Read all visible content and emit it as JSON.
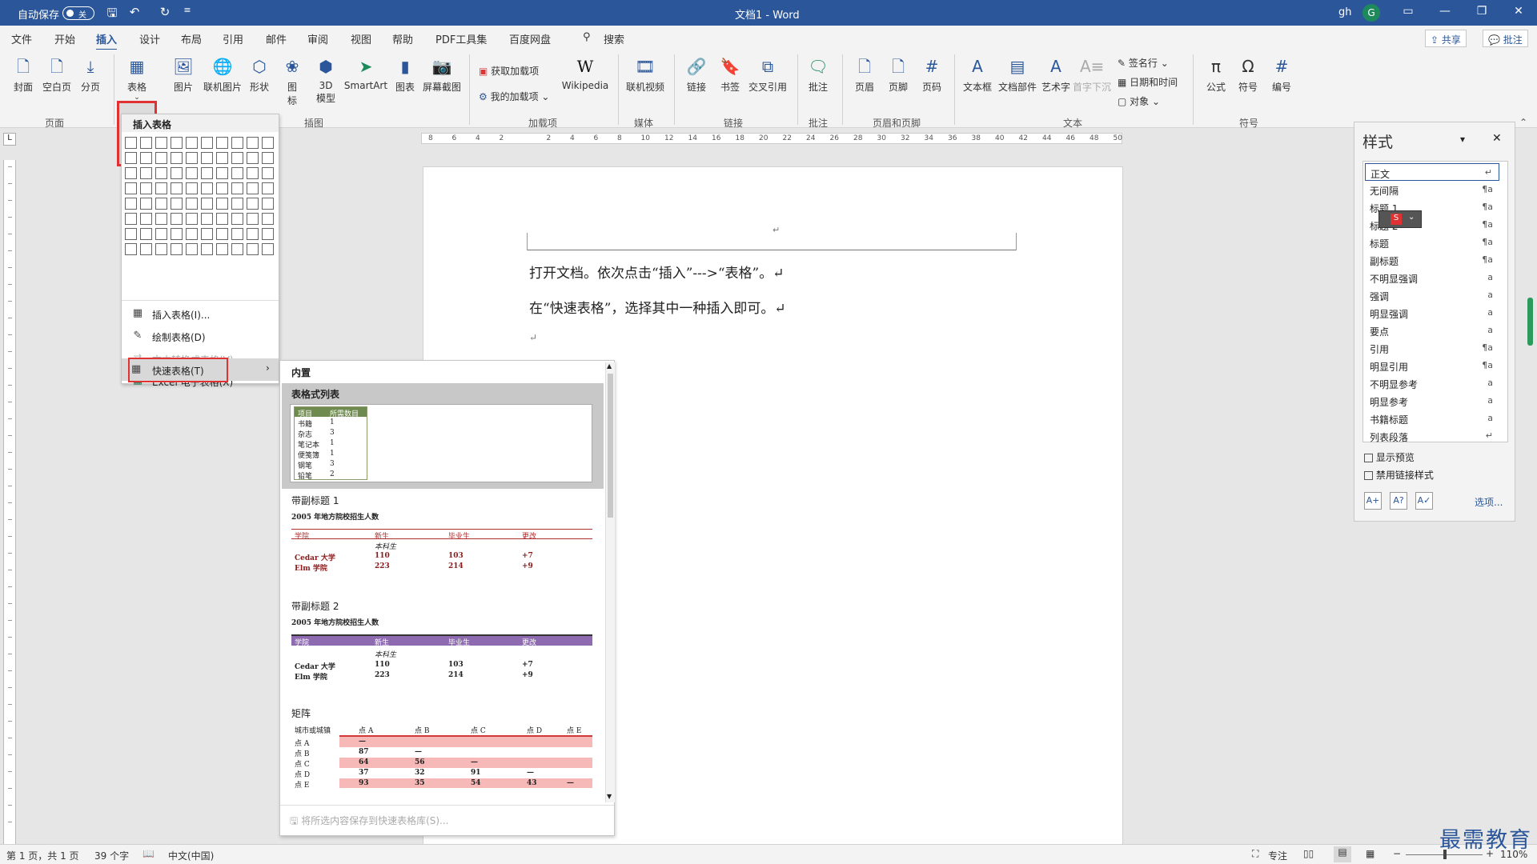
{
  "titlebar": {
    "autosave": "自动保存",
    "autosave_state": "关",
    "doc_title": "文档1 - Word",
    "user": "gh",
    "avatar": "G"
  },
  "tabs": [
    "文件",
    "开始",
    "插入",
    "设计",
    "布局",
    "引用",
    "邮件",
    "审阅",
    "视图",
    "帮助",
    "PDF工具集",
    "百度网盘"
  ],
  "search_label": "搜索",
  "share_label": "共享",
  "comment_label": "批注",
  "ribbon": {
    "page_group": {
      "label": "页面",
      "cover": "封面",
      "blank": "空白页",
      "break": "分页"
    },
    "table": "表格",
    "illus": {
      "label": "插图",
      "picture": "图片",
      "online_picture": "联机图片",
      "shapes": "形状",
      "icons_1": "图",
      "icons_2": "标",
      "model_1": "3D",
      "model_2": "模型",
      "smartart": "SmartArt",
      "chart": "图表",
      "screenshot": "屏幕截图"
    },
    "addins": {
      "label": "加载项",
      "get": "获取加载项",
      "mine": "我的加载项",
      "wikipedia": "Wikipedia"
    },
    "media": {
      "label": "媒体",
      "video": "联机视频"
    },
    "links": {
      "label": "链接",
      "link": "链接",
      "bookmark": "书签",
      "cross": "交叉引用"
    },
    "comments": {
      "label": "批注",
      "comment": "批注"
    },
    "hf": {
      "label": "页眉和页脚",
      "header": "页眉",
      "footer": "页脚",
      "pagenum": "页码"
    },
    "text": {
      "label": "文本",
      "textbox": "文本框",
      "quickparts": "文档部件",
      "wordart": "艺术字",
      "dropcap": "首字下沉",
      "signature": "签名行",
      "datetime": "日期和时间",
      "object": "对象"
    },
    "symbols": {
      "label": "符号",
      "equation": "公式",
      "symbol": "符号",
      "number": "编号"
    }
  },
  "dropdown": {
    "header": "插入表格",
    "items": [
      "插入表格(I)...",
      "绘制表格(D)",
      "文本转换成表格(V)...",
      "Excel 电子表格(X)",
      "快速表格(T)"
    ]
  },
  "submenu": {
    "header": "内置",
    "footer": "将所选内容保存到快速表格库(S)...",
    "g1": {
      "title": "表格式列表",
      "headers": [
        "项目",
        "所需数目"
      ],
      "rows": [
        [
          "书籍",
          "1"
        ],
        [
          "杂志",
          "3"
        ],
        [
          "笔记本",
          "1"
        ],
        [
          "便笺簿",
          "1"
        ],
        [
          "钢笔",
          "3"
        ],
        [
          "铅笔",
          "2"
        ]
      ]
    },
    "g2": {
      "title": "带副标题 1",
      "caption": "2005 年地方院校招生人数",
      "headers": [
        "学院",
        "新生",
        "毕业生",
        "更改"
      ],
      "sub": "本科生",
      "rows": [
        [
          "Cedar 大学",
          "110",
          "103",
          "+7"
        ],
        [
          "Elm 学院",
          "223",
          "214",
          "+9"
        ]
      ]
    },
    "g3": {
      "title": "带副标题 2",
      "caption": "2005 年地方院校招生人数",
      "headers": [
        "学院",
        "新生",
        "毕业生",
        "更改"
      ],
      "sub": "本科生",
      "rows": [
        [
          "Cedar 大学",
          "110",
          "103",
          "+7"
        ],
        [
          "Elm 学院",
          "223",
          "214",
          "+9"
        ]
      ]
    },
    "g4": {
      "title": "矩阵",
      "headers": [
        "城市或城镇",
        "点 A",
        "点 B",
        "点 C",
        "点 D",
        "点 E"
      ],
      "rows": [
        [
          "点 A",
          "—",
          "",
          "",
          "",
          ""
        ],
        [
          "点 B",
          "87",
          "—",
          "",
          "",
          ""
        ],
        [
          "点 C",
          "64",
          "56",
          "—",
          "",
          ""
        ],
        [
          "点 D",
          "37",
          "32",
          "91",
          "—",
          ""
        ],
        [
          "点 E",
          "93",
          "35",
          "54",
          "43",
          "—"
        ]
      ]
    }
  },
  "document": {
    "line1": "打开文档。依次点击“插入”--->“表格”。↵",
    "line2": "在“快速表格”，选择其中一种插入即可。↵",
    "line3": "↵",
    "header_mark": "↵"
  },
  "styles": {
    "title": "样式",
    "items": [
      {
        "name": "正文",
        "mark": "↵"
      },
      {
        "name": "无间隔",
        "mark": "¶a"
      },
      {
        "name": "标题 1",
        "mark": "¶a"
      },
      {
        "name": "标题 2",
        "mark": "¶a"
      },
      {
        "name": "标题",
        "mark": "¶a"
      },
      {
        "name": "副标题",
        "mark": "¶a"
      },
      {
        "name": "不明显强调",
        "mark": "a"
      },
      {
        "name": "强调",
        "mark": "a"
      },
      {
        "name": "明显强调",
        "mark": "a"
      },
      {
        "name": "要点",
        "mark": "a"
      },
      {
        "name": "引用",
        "mark": "¶a"
      },
      {
        "name": "明显引用",
        "mark": "¶a"
      },
      {
        "name": "不明显参考",
        "mark": "a"
      },
      {
        "name": "明显参考",
        "mark": "a"
      },
      {
        "name": "书籍标题",
        "mark": "a"
      },
      {
        "name": "列表段落",
        "mark": "↵"
      }
    ],
    "show_preview": "显示预览",
    "disable_linked": "禁用链接样式",
    "options": "选项..."
  },
  "ruler_numbers": [
    "8",
    "6",
    "4",
    "2",
    "",
    "2",
    "4",
    "6",
    "8",
    "10",
    "12",
    "14",
    "16",
    "18",
    "20",
    "22",
    "24",
    "26",
    "28",
    "30",
    "32",
    "34",
    "36",
    "38",
    "40",
    "42",
    "44",
    "46",
    "48",
    "50"
  ],
  "status": {
    "page": "第 1 页，共 1 页",
    "words": "39 个字",
    "lang": "中文(中国)",
    "focus": "专注",
    "zoom": "110%"
  },
  "watermark": "最需教育",
  "colors": {
    "brand": "#2b579a",
    "highlight": "#e03232"
  }
}
